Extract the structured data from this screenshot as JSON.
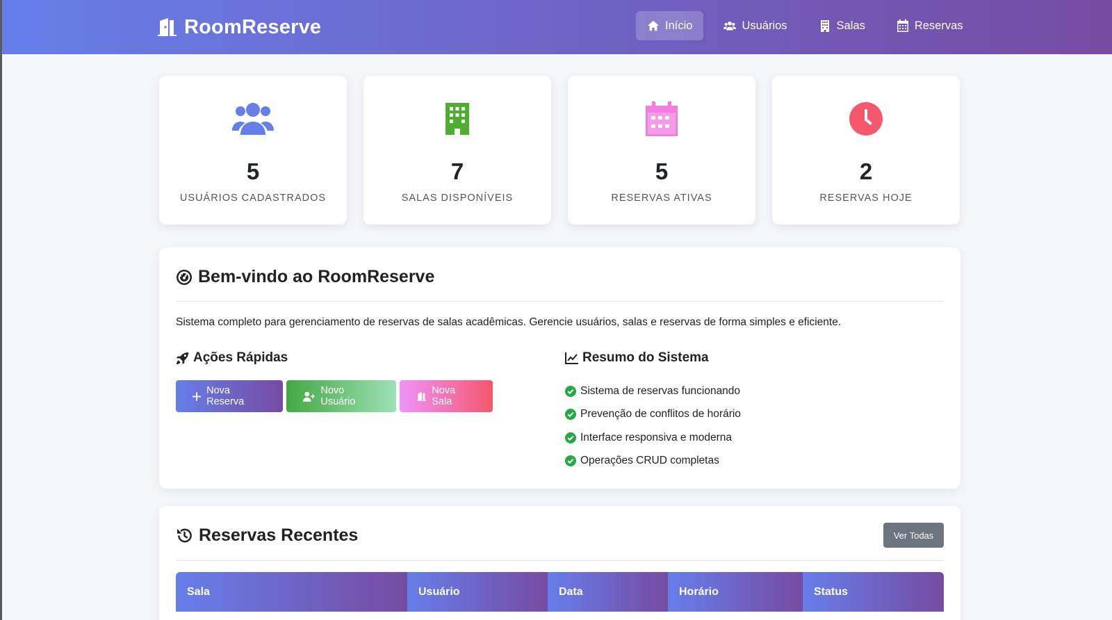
{
  "brand": {
    "name": "RoomReserve"
  },
  "nav": [
    {
      "label": "Início",
      "icon": "home-icon",
      "active": true
    },
    {
      "label": "Usuários",
      "icon": "users-icon"
    },
    {
      "label": "Salas",
      "icon": "building-icon"
    },
    {
      "label": "Reservas",
      "icon": "calendar-icon"
    }
  ],
  "stats": [
    {
      "value": "5",
      "label": "Usuários Cadastrados",
      "icon": "users-icon",
      "color": "#667eea"
    },
    {
      "value": "7",
      "label": "Salas Disponíveis",
      "icon": "building-icon",
      "color": "#4caf30"
    },
    {
      "value": "5",
      "label": "Reservas Ativas",
      "icon": "calendar-icon",
      "color": "#f07ddf"
    },
    {
      "value": "2",
      "label": "Reservas Hoje",
      "icon": "clock-icon",
      "color": "#f5576c"
    }
  ],
  "welcome": {
    "title": "Bem-vindo ao RoomReserve",
    "description": "Sistema completo para gerenciamento de reservas de salas acadêmicas. Gerencie usuários, salas e reservas de forma simples e eficiente.",
    "quick_actions": {
      "title": "Ações Rápidas",
      "buttons": [
        {
          "label": "Nova Reserva",
          "icon": "plus-icon"
        },
        {
          "label": "Novo Usuário",
          "icon": "user-plus-icon"
        },
        {
          "label": "Nova Sala",
          "icon": "door-icon"
        }
      ]
    },
    "summary": {
      "title": "Resumo do Sistema",
      "items": [
        "Sistema de reservas funcionando",
        "Prevenção de conflitos de horário",
        "Interface responsiva e moderna",
        "Operações CRUD completas"
      ]
    }
  },
  "recent": {
    "title": "Reservas Recentes",
    "view_all": "Ver Todas",
    "columns": [
      "Sala",
      "Usuário",
      "Data",
      "Horário",
      "Status"
    ]
  }
}
